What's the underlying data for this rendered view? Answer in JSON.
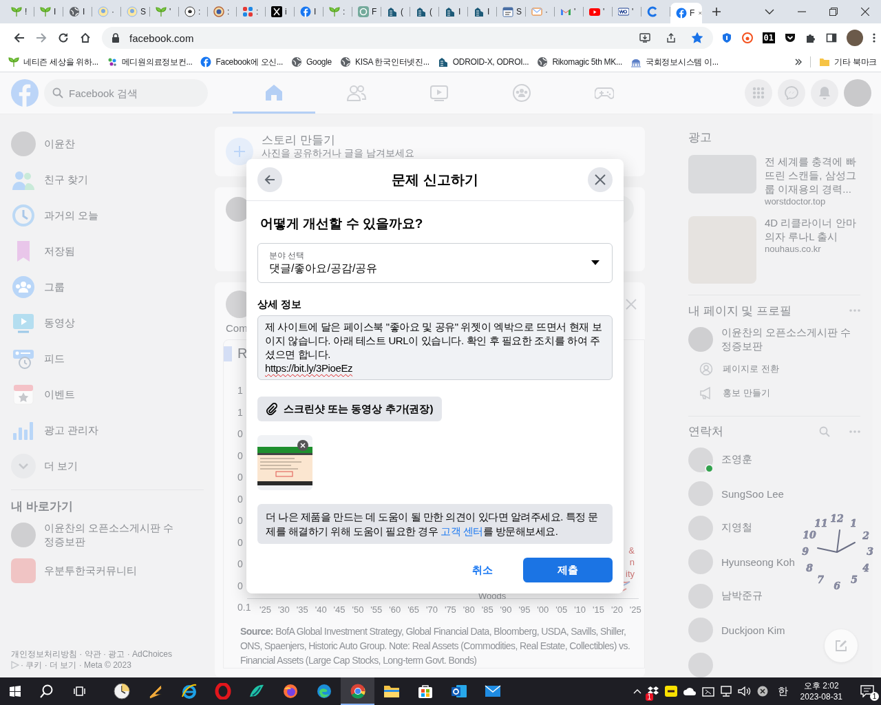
{
  "browser": {
    "tabs": [
      {
        "kind": "sprout",
        "title": "!",
        "selected": false
      },
      {
        "kind": "sprout",
        "title": "I",
        "selected": false
      },
      {
        "kind": "globe",
        "title": "I",
        "selected": false
      },
      {
        "kind": "avatar",
        "title": "·",
        "selected": false
      },
      {
        "kind": "avatar",
        "title": "S",
        "selected": false
      },
      {
        "kind": "sprout",
        "title": "'",
        "selected": false
      },
      {
        "kind": "soccer",
        "title": ":",
        "selected": false
      },
      {
        "kind": "seal",
        "title": ":",
        "selected": false
      },
      {
        "kind": "puzzle",
        "title": ":",
        "selected": false
      },
      {
        "kind": "x",
        "title": "i",
        "selected": false
      },
      {
        "kind": "facebook",
        "title": "I",
        "selected": false
      },
      {
        "kind": "sprout",
        "title": ":",
        "selected": false
      },
      {
        "kind": "knot",
        "title": "F",
        "selected": false
      },
      {
        "kind": "odroid",
        "title": "(",
        "selected": false
      },
      {
        "kind": "odroid",
        "title": "(",
        "selected": false
      },
      {
        "kind": "odroid",
        "title": "I",
        "selected": false
      },
      {
        "kind": "odroid",
        "title": "I",
        "selected": false
      },
      {
        "kind": "sms",
        "title": "S",
        "selected": false
      },
      {
        "kind": "mail",
        "title": "·",
        "selected": false
      },
      {
        "kind": "gmail",
        "title": "'",
        "selected": false
      },
      {
        "kind": "youtube",
        "title": "'",
        "selected": false
      },
      {
        "kind": "wo",
        "title": "'",
        "selected": false
      },
      {
        "kind": "c",
        "selected": false
      },
      {
        "kind": "facebook",
        "title": "F",
        "selected": true
      }
    ],
    "url": "facebook.com",
    "page_bookmarked": true,
    "extension_badge": "01",
    "bookmarks": [
      {
        "kind": "sprout",
        "label": "네티즌 세상을 위하..."
      },
      {
        "kind": "medi",
        "label": "메디원의료정보컨..."
      },
      {
        "kind": "facebook",
        "label": "Facebook에 오신..."
      },
      {
        "kind": "globe",
        "label": "Google"
      },
      {
        "kind": "globe",
        "label": "KISA 한국인터넷진..."
      },
      {
        "kind": "odroid",
        "label": "ODROID-X, ODROI..."
      },
      {
        "kind": "globe",
        "label": "Rikomagic 5th MK..."
      },
      {
        "kind": "assembly",
        "label": "국회정보시스템 이..."
      }
    ],
    "other_bookmarks": "기타 북마크"
  },
  "facebook": {
    "search_placeholder": "Facebook 검색",
    "nav": [
      {
        "kind": "home",
        "selected": true
      },
      {
        "kind": "friends",
        "selected": false
      },
      {
        "kind": "video",
        "selected": false
      },
      {
        "kind": "groups",
        "selected": false
      },
      {
        "kind": "gaming",
        "selected": false
      }
    ],
    "sidebar": {
      "items": [
        {
          "kind": "avatar",
          "label": "이윤찬"
        },
        {
          "kind": "friends",
          "label": "친구 찾기"
        },
        {
          "kind": "memories",
          "label": "과거의 오늘"
        },
        {
          "kind": "saved",
          "label": "저장됨"
        },
        {
          "kind": "groups",
          "label": "그룹"
        },
        {
          "kind": "video",
          "label": "동영상"
        },
        {
          "kind": "feeds",
          "label": "피드"
        },
        {
          "kind": "events",
          "label": "이벤트"
        },
        {
          "kind": "ads",
          "label": "광고 관리자"
        },
        {
          "kind": "more",
          "label": "더 보기"
        }
      ],
      "shortcuts_title": "내 바로가기",
      "shortcuts": [
        {
          "kind": "avatar",
          "label": "이윤찬의 오픈소스게시판 수정증보판"
        },
        {
          "kind": "community",
          "label": "우분투한국커뮤니티"
        }
      ],
      "footer": [
        "개인정보처리방침 · 약관 · 광고 · AdChoices",
        "· 쿠키 · 더 보기 · Meta © 2023"
      ]
    },
    "story": {
      "title": "스토리 만들기",
      "subtitle": "사진을 공유하거나 글을 남겨보세요"
    },
    "post": {
      "author": "Com",
      "chart_title": "R",
      "y_labels": [
        "1",
        "1",
        "0",
        "0",
        "0",
        "0",
        "0",
        "0",
        "0",
        "0",
        "0.1"
      ],
      "x_ticks": [
        "'25",
        "'30",
        "'35",
        "'40",
        "'45",
        "'50",
        "'55",
        "'60",
        "'65",
        "'70",
        "'75",
        "'80",
        "'85",
        "'90",
        "'95",
        "'00",
        "'05",
        "'10",
        "'15",
        "'20",
        "'25"
      ],
      "fragments": [
        "&",
        "n",
        "ity"
      ],
      "series_label": "Woods",
      "source": "**Source:** BofA Global Investment Strategy, Global Financial Data, Bloomberg, USDA, Savills, Shiller, ONS, Spaenjers, Historic Auto Group. Note: Real Assets (Commodities, Real Estate, Collectibles) vs. Financial Assets (Large Cap Stocks, Long-term Govt. Bonds)"
    },
    "right": {
      "ads_title": "광고",
      "ads": [
        {
          "title": "전 세계를 충격에 빠뜨린 스캔들, 삼성그룹 이재용의 경력...",
          "domain": "worstdoctor.top"
        },
        {
          "title": "4D 리클라이너 안마의자 루나L 출시",
          "domain": "nouhaus.co.kr"
        }
      ],
      "pages_title": "내 페이지 및 프로필",
      "page_name": "이윤찬의 오픈소스게시판 수정증보판",
      "page_actions": [
        {
          "kind": "switch",
          "label": "페이지로 전환"
        },
        {
          "kind": "megaphone",
          "label": "홍보 만들기"
        }
      ],
      "contacts_title": "연락처",
      "contacts": [
        {
          "name": "조영훈",
          "online": true
        },
        {
          "name": "SungSoo Lee",
          "online": false
        },
        {
          "name": "지영철",
          "online": false
        },
        {
          "name": "Hyunseong Koh",
          "online": false
        },
        {
          "name": "남박준규",
          "online": false
        },
        {
          "name": "Duckjoon Kim",
          "online": false
        }
      ]
    }
  },
  "modal": {
    "title": "문제 신고하기",
    "question": "어떻게 개선할 수 있을까요?",
    "select": {
      "label": "분야 선택",
      "value": "댓글/좋아요/공감/공유"
    },
    "details_label": "상세 정보",
    "details_lines": [
      {
        "text": "제 사이트에 달은 페이스북 \"좋아요 및 공유\" 위젯이 엑박으로 뜨면서 현재 보이지 않습니다. 아래 테스트 URL이 있습니다. 확인 후 필요한 조치를 하여 주셨으면 합니다.",
        "misspelled": false
      },
      {
        "text": "https://bit.ly/3PioeEz",
        "misspelled": true
      }
    ],
    "attach_button": "스크린샷 또는 동영상 추가(권장)",
    "info": {
      "before": "더 나은 제품을 만드는 데 도움이 될 만한 의견이 있다면 알려주세요. 특정 문제를 해결하기 위해 도움이 필요한 경우 ",
      "link": "고객 센터",
      "after": "를 방문해보세요."
    },
    "cancel": "취소",
    "submit": "제출"
  },
  "clock": {
    "numerals": [
      "12",
      "11",
      "1",
      "10",
      "2",
      "9",
      "3",
      "8",
      "4",
      "7",
      "5",
      "6"
    ]
  },
  "taskbar": {
    "apps": [
      {
        "kind": "clock",
        "active": false
      },
      {
        "kind": "bolt",
        "active": false
      },
      {
        "kind": "ie",
        "active": false
      },
      {
        "kind": "opera",
        "active": false
      },
      {
        "kind": "bird",
        "active": false
      },
      {
        "kind": "firefox",
        "active": false
      },
      {
        "kind": "edge",
        "active": false
      },
      {
        "kind": "chrome",
        "active": true
      },
      {
        "kind": "folder",
        "active": false
      },
      {
        "kind": "store",
        "active": false
      },
      {
        "kind": "outlook",
        "active": false
      },
      {
        "kind": "mail",
        "active": false
      }
    ],
    "tray_badge": "1",
    "ime": "한",
    "time": "오후 2:02",
    "date": "2023-08-31",
    "notifications": "1"
  }
}
